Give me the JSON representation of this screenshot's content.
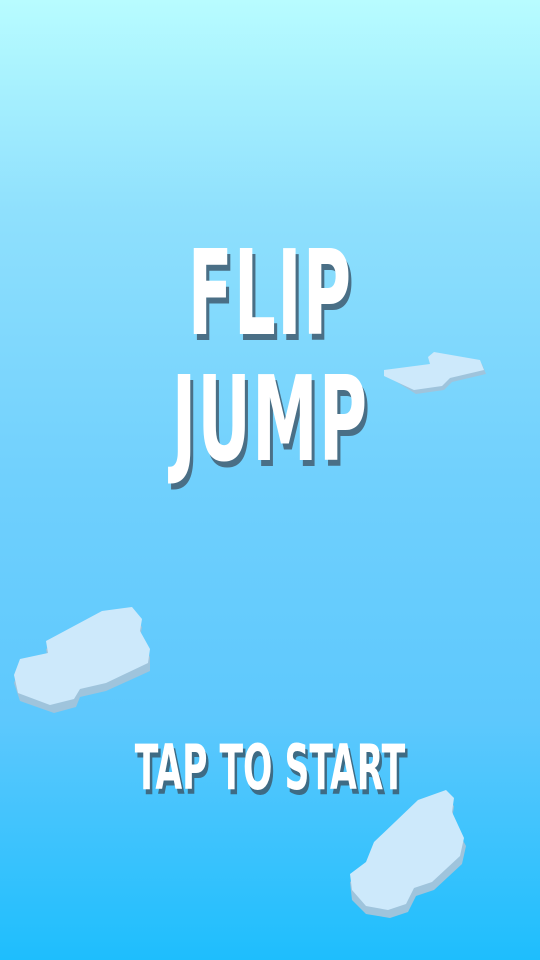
{
  "game": {
    "title_line1": "FLIP",
    "title_line2": "JUMP",
    "start_prompt": "TAP TO START"
  },
  "colors": {
    "sky_top": "#b8fcff",
    "sky_bottom": "#1ebefd",
    "title_text": "#ffffff",
    "title_shadow": "#4a6f86",
    "platform_top": "#cde9fb",
    "platform_side": "#9fc4dc"
  },
  "icons": {
    "platforms": [
      "cloud-platform-icon",
      "cloud-platform-icon",
      "cloud-platform-icon"
    ]
  }
}
